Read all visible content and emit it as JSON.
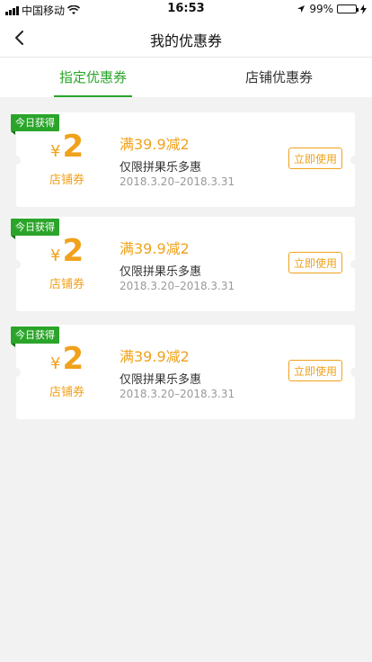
{
  "status_bar": {
    "carrier": "中国移动",
    "time": "16:53",
    "battery": "99%",
    "battery_level": 0.99
  },
  "header": {
    "title": "我的优惠券"
  },
  "tabs": [
    {
      "label": "指定优惠券",
      "active": true
    },
    {
      "label": "店铺优惠券",
      "active": false
    }
  ],
  "coupons": [
    {
      "badge": "今日获得",
      "currency": "¥",
      "amount": "2",
      "type": "店铺券",
      "title": "满39.9减2",
      "desc": "仅限拼果乐多惠",
      "date": "2018.3.20–2018.3.31",
      "button": "立即使用"
    },
    {
      "badge": "今日获得",
      "currency": "¥",
      "amount": "2",
      "type": "店铺券",
      "title": "满39.9减2",
      "desc": "仅限拼果乐多惠",
      "date": "2018.3.20–2018.3.31",
      "button": "立即使用"
    },
    {
      "badge": "今日获得",
      "currency": "¥",
      "amount": "2",
      "type": "店铺券",
      "title": "满39.9减2",
      "desc": "仅限拼果乐多惠",
      "date": "2018.3.20–2018.3.31",
      "button": "立即使用"
    }
  ],
  "colors": {
    "accent_green": "#2aa52a",
    "coupon_orange": "#f0a21c"
  }
}
